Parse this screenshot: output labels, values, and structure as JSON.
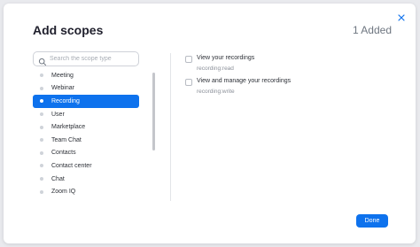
{
  "dialog": {
    "title": "Add scopes",
    "added_count": "1 Added",
    "close_icon": "close-icon"
  },
  "search": {
    "placeholder": "Search the scope type",
    "value": ""
  },
  "categories": {
    "items": [
      {
        "label": "Meeting"
      },
      {
        "label": "Webinar"
      },
      {
        "label": "Recording"
      },
      {
        "label": "User"
      },
      {
        "label": "Marketplace"
      },
      {
        "label": "Team Chat"
      },
      {
        "label": "Contacts"
      },
      {
        "label": "Contact center"
      },
      {
        "label": "Chat"
      },
      {
        "label": "Zoom IQ"
      }
    ],
    "selected": "Recording"
  },
  "scopes": [
    {
      "label": "View your recordings",
      "key": "recording:read",
      "checked": false
    },
    {
      "label": "View and manage your recordings",
      "key": "recording:write",
      "checked": false
    }
  ],
  "footer": {
    "done_label": "Done"
  },
  "colors": {
    "accent": "#0e72ed",
    "title": "#1f1f2c",
    "muted": "#6e7680"
  }
}
